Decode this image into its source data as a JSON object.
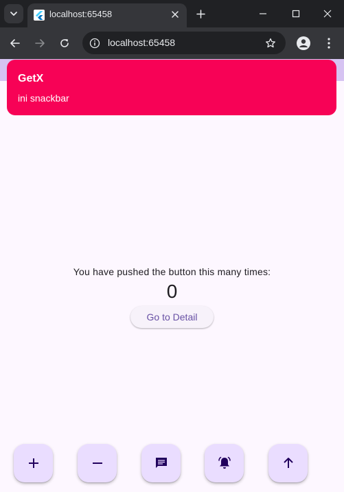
{
  "browser": {
    "tab": {
      "title": "localhost:65458"
    },
    "address_bar": {
      "url": "localhost:65458"
    }
  },
  "snackbar": {
    "title": "GetX",
    "message": "ini snackbar",
    "color": "#f70256"
  },
  "main": {
    "counter_label": "You have pushed the button this many times:",
    "counter_value": "0",
    "detail_button_label": "Go to Detail"
  },
  "fabs": [
    {
      "name": "increment",
      "icon": "plus-icon"
    },
    {
      "name": "decrement",
      "icon": "minus-icon"
    },
    {
      "name": "message",
      "icon": "chat-icon"
    },
    {
      "name": "alarm",
      "icon": "notification-bell-icon"
    },
    {
      "name": "scroll-up",
      "icon": "arrow-up-icon"
    }
  ],
  "colors": {
    "accent": "#6750a4",
    "fab_background": "#eaddff",
    "page_background": "#fdf7ff",
    "app_bar": "#d6c3f2"
  }
}
